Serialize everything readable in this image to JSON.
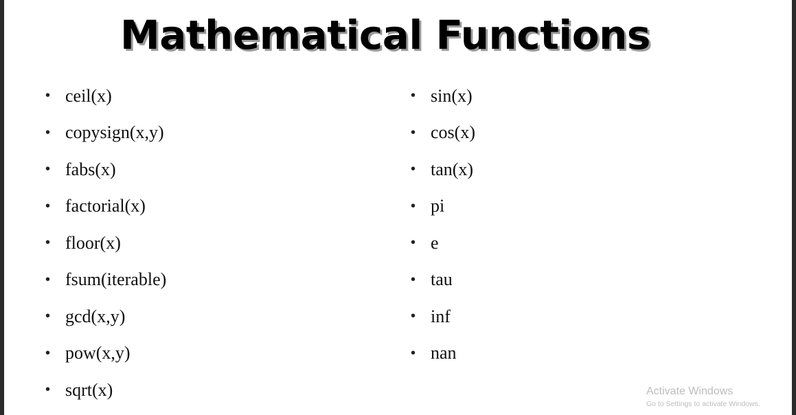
{
  "slide": {
    "title": "Mathematical Functions",
    "bullet_glyph": "•",
    "left_column": [
      "ceil(x)",
      "copysign(x,y)",
      "fabs(x)",
      "factorial(x)",
      "floor(x)",
      "fsum(iterable)",
      "gcd(x,y)",
      "pow(x,y)",
      "sqrt(x)"
    ],
    "right_column": [
      "sin(x)",
      "cos(x)",
      "tan(x)",
      "pi",
      "e",
      "tau",
      "inf",
      "nan"
    ]
  },
  "watermark": {
    "title": "Activate Windows",
    "subtitle": "Go to Settings to activate Windows."
  },
  "colors": {
    "slide_background": "#ffffff",
    "frame_background": "#2b2b2b",
    "title_shadow": "#9a9a9a",
    "watermark": "#bcbcbc"
  }
}
